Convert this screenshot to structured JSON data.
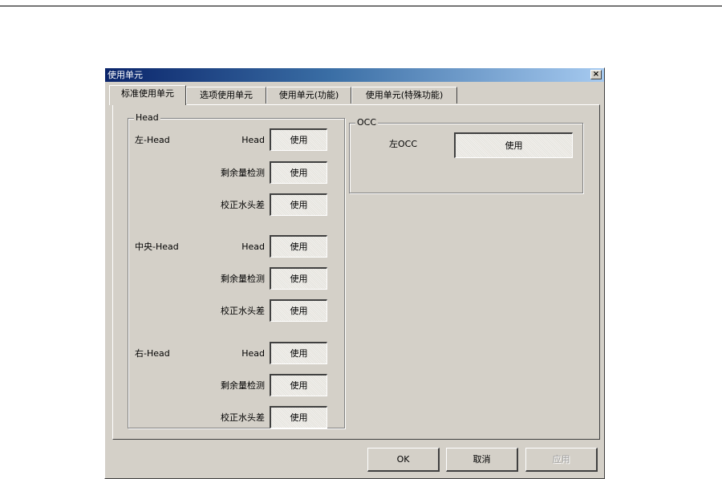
{
  "dialog": {
    "title": "使用单元",
    "close_label": "×"
  },
  "tabs": [
    {
      "label": "标准使用单元",
      "active": true
    },
    {
      "label": "选项使用单元",
      "active": false
    },
    {
      "label": "使用单元(功能)",
      "active": false
    },
    {
      "label": "使用单元(特殊功能)",
      "active": false
    }
  ],
  "head_group": {
    "title": "Head",
    "units": [
      {
        "name": "左-Head",
        "rows": [
          {
            "label": "Head",
            "value": "使用"
          },
          {
            "label": "剩余量检测",
            "value": "使用"
          },
          {
            "label": "校正水头差",
            "value": "使用"
          }
        ]
      },
      {
        "name": "中央-Head",
        "rows": [
          {
            "label": "Head",
            "value": "使用"
          },
          {
            "label": "剩余量检测",
            "value": "使用"
          },
          {
            "label": "校正水头差",
            "value": "使用"
          }
        ]
      },
      {
        "name": "右-Head",
        "rows": [
          {
            "label": "Head",
            "value": "使用"
          },
          {
            "label": "剩余量检测",
            "value": "使用"
          },
          {
            "label": "校正水头差",
            "value": "使用"
          }
        ]
      }
    ]
  },
  "occ_group": {
    "title": "OCC",
    "label": "左OCC",
    "value": "使用"
  },
  "buttons": {
    "ok": "OK",
    "cancel": "取消",
    "apply": "应用"
  }
}
